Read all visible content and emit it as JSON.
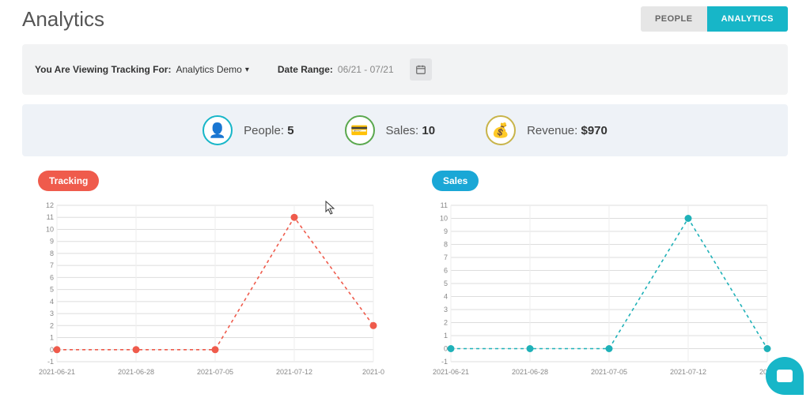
{
  "header": {
    "title": "Analytics",
    "tabs": {
      "people": "People",
      "analytics": "Analytics"
    }
  },
  "filter": {
    "label": "You Are Viewing Tracking For:",
    "selected": "Analytics Demo",
    "date_label": "Date Range:",
    "date_range": "06/21 - 07/21"
  },
  "stats": {
    "people": {
      "label": "People:",
      "value": "5"
    },
    "sales": {
      "label": "Sales:",
      "value": "10"
    },
    "revenue": {
      "label": "Revenue:",
      "value": "$970"
    }
  },
  "badges": {
    "tracking": "Tracking",
    "sales": "Sales"
  },
  "chart_data": [
    {
      "type": "line",
      "title": "Tracking",
      "color": "#ef5b4c",
      "categories": [
        "2021-06-21",
        "2021-06-28",
        "2021-07-05",
        "2021-07-12",
        "2021-0"
      ],
      "values": [
        0,
        0,
        0,
        11,
        2
      ],
      "ylim": [
        -1,
        12
      ],
      "yticks": [
        -1,
        0,
        1,
        2,
        3,
        4,
        5,
        6,
        7,
        8,
        9,
        10,
        11,
        12
      ],
      "xlabel": "",
      "ylabel": ""
    },
    {
      "type": "line",
      "title": "Sales",
      "color": "#1fb1b8",
      "categories": [
        "2021-06-21",
        "2021-06-28",
        "2021-07-05",
        "2021-07-12",
        "2021"
      ],
      "values": [
        0,
        0,
        0,
        10,
        0
      ],
      "ylim": [
        -1,
        11
      ],
      "yticks": [
        -1,
        0,
        1,
        2,
        3,
        4,
        5,
        6,
        7,
        8,
        9,
        10,
        11
      ],
      "xlabel": "",
      "ylabel": ""
    }
  ]
}
